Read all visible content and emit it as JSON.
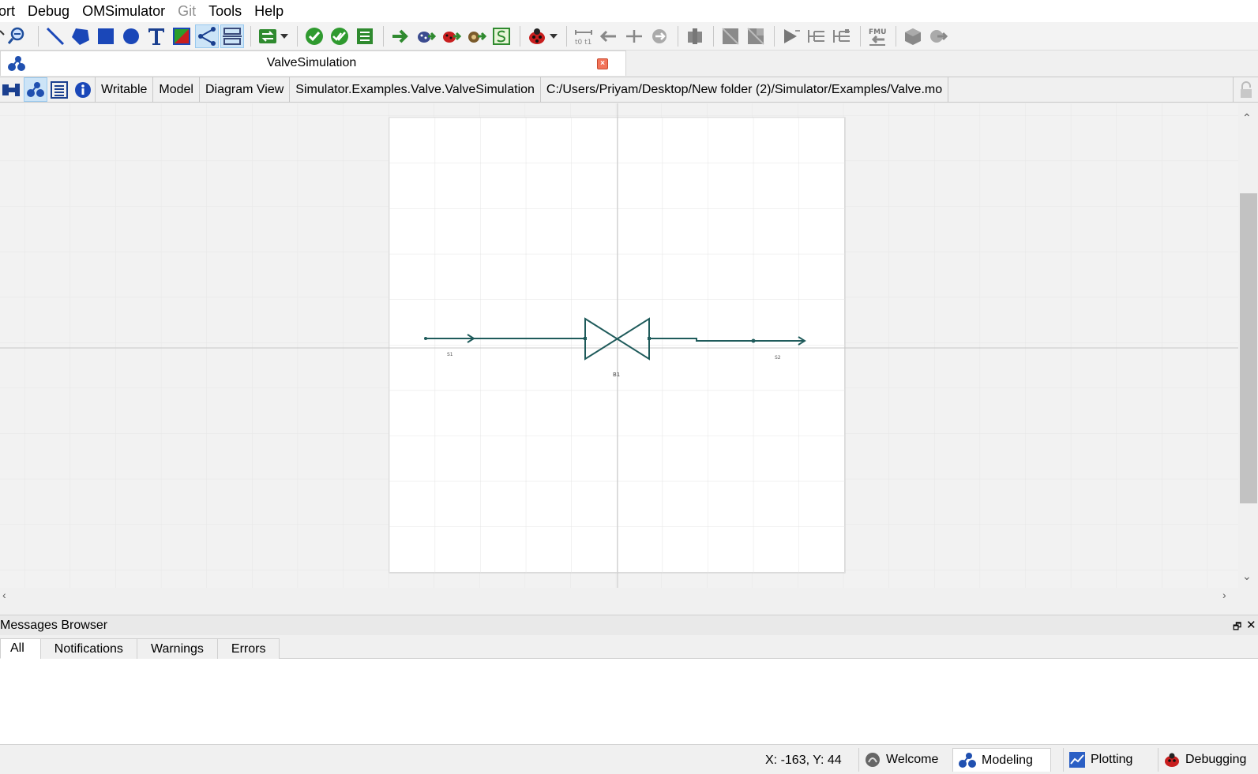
{
  "menubar": {
    "items": [
      {
        "label": "ort",
        "disabled": false
      },
      {
        "label": "Debug",
        "disabled": false
      },
      {
        "label": "OMSimulator",
        "disabled": false
      },
      {
        "label": "Git",
        "disabled": true
      },
      {
        "label": "Tools",
        "disabled": false
      },
      {
        "label": "Help",
        "disabled": false
      }
    ]
  },
  "document_tab": {
    "title": "ValveSimulation",
    "close_glyph": "×"
  },
  "infobar": {
    "access": "Writable",
    "restriction": "Model",
    "view": "Diagram View",
    "class_name": "Simulator.Examples.Valve.ValveSimulation",
    "file_path": "C:/Users/Priyam/Desktop/New folder (2)/Simulator/Examples/Valve.mo"
  },
  "diagram": {
    "components": [
      {
        "name": "S1",
        "kind": "source"
      },
      {
        "name": "B1",
        "kind": "valve"
      },
      {
        "name": "S2",
        "kind": "sink"
      }
    ],
    "line_color": "#1f5b5b"
  },
  "messages": {
    "title": "Messages Browser",
    "float_glyph": "🗗",
    "close_glyph": "✕",
    "tabs": [
      "All",
      "Notifications",
      "Warnings",
      "Errors"
    ],
    "active_tab": "All"
  },
  "statusbar": {
    "coordinates": "X: -163, Y: 44",
    "perspectives": [
      "Welcome",
      "Modeling",
      "Plotting",
      "Debugging"
    ],
    "active_perspective": "Modeling"
  },
  "icons": {
    "toolbar": [
      "zoom-out-icon",
      "line-tool-icon",
      "polygon-tool-icon",
      "rectangle-tool-icon",
      "ellipse-tool-icon",
      "text-tool-icon",
      "bitmap-tool-icon",
      "connect-mode-icon",
      "transition-mode-icon",
      "simulation-setup-icon",
      "check-model-icon",
      "check-all-models-icon",
      "instantiate-model-icon",
      "simulate-icon",
      "simulate-debugger-icon",
      "simulate-algorithmic-debugger-icon",
      "simulate-animation-icon",
      "simulate-ssp-icon",
      "debugger-icon",
      "fmu-import-icon"
    ]
  }
}
